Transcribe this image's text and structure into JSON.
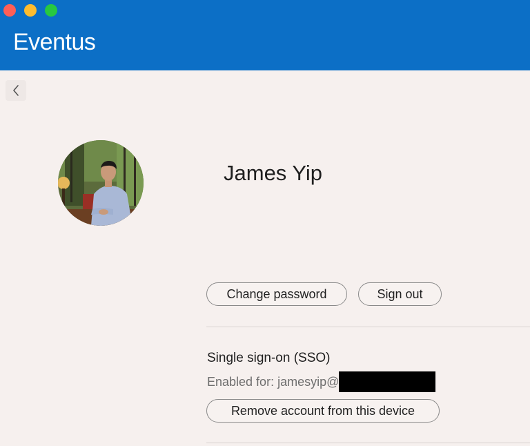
{
  "app": {
    "title": "Eventus"
  },
  "profile": {
    "name": "James Yip"
  },
  "actions": {
    "change_password": "Change password",
    "sign_out": "Sign out"
  },
  "sso": {
    "title": "Single sign-on (SSO)",
    "enabled_prefix": "Enabled for: jamesyip@",
    "remove_account": "Remove account from this device"
  },
  "colors": {
    "titlebar": "#0c6fc6",
    "background": "#f6f0ee"
  }
}
